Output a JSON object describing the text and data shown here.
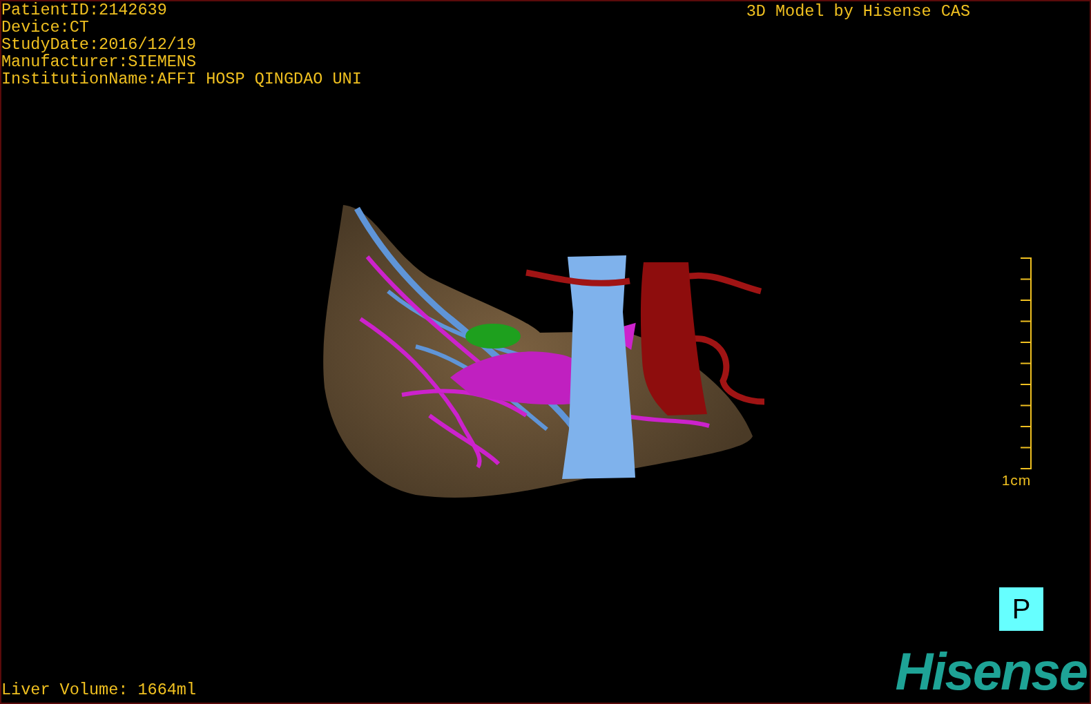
{
  "patient_info": [
    "PatientID:2142639",
    "Device:CT",
    "StudyDate:2016/12/19",
    "Manufacturer:SIEMENS",
    "InstitutionName:AFFI HOSP QINGDAO UNI"
  ],
  "title": "3D Model by Hisense CAS",
  "scale_bar": {
    "label": "1cm"
  },
  "liver_volume": "Liver Volume: 1664ml",
  "orientation_button": "P",
  "logo": "Hisense"
}
